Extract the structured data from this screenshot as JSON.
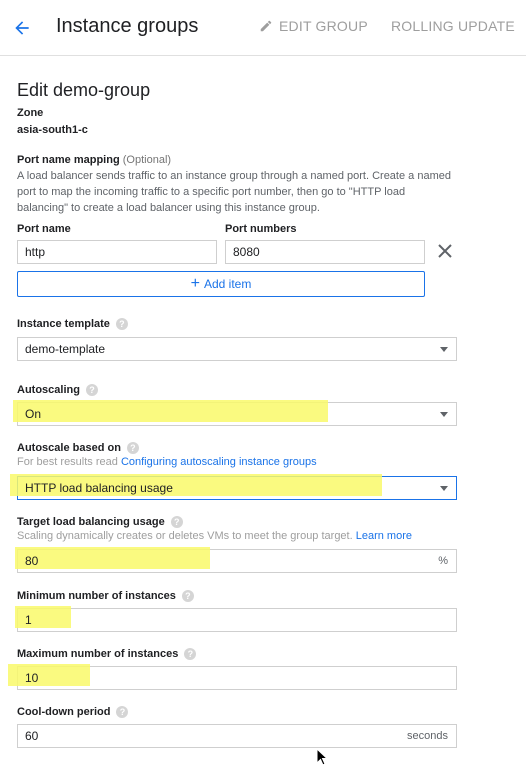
{
  "header": {
    "title": "Instance groups",
    "edit_group": "EDIT GROUP",
    "rolling_update": "ROLLING UPDATE"
  },
  "form": {
    "title": "Edit demo-group",
    "zone": {
      "label": "Zone",
      "value": "asia-south1-c"
    },
    "port_mapping": {
      "label": "Port name mapping",
      "optional": "(Optional)",
      "description": "A load balancer sends traffic to an instance group through a named port. Create a named port to map the incoming traffic to a specific port number, then go to \"HTTP load balancing\" to create a load balancer using this instance group.",
      "port_name_label": "Port name",
      "port_numbers_label": "Port numbers",
      "port_name_value": "http",
      "port_numbers_value": "8080",
      "add_item": "Add item"
    },
    "instance_template": {
      "label": "Instance template",
      "value": "demo-template"
    },
    "autoscaling": {
      "label": "Autoscaling",
      "value": "On"
    },
    "autoscale_based_on": {
      "label": "Autoscale based on",
      "hint_prefix": "For best results read ",
      "hint_link": "Configuring autoscaling instance groups",
      "value": "HTTP load balancing usage"
    },
    "target_lb_usage": {
      "label": "Target load balancing usage",
      "hint": "Scaling dynamically creates or deletes VMs to meet the group target.",
      "hint_link": "Learn more",
      "value": "80",
      "suffix": "%"
    },
    "min_instances": {
      "label": "Minimum number of instances",
      "value": "1"
    },
    "max_instances": {
      "label": "Maximum number of instances",
      "value": "10"
    },
    "cooldown": {
      "label": "Cool-down period",
      "value": "60",
      "suffix": "seconds"
    }
  },
  "colors": {
    "accent": "#1a73e8",
    "highlight": "#f9f96a",
    "muted": "#9e9e9e"
  },
  "icons": [
    "arrow-back-icon",
    "pencil-icon",
    "help-icon",
    "close-icon",
    "plus-icon",
    "dropdown-caret-icon",
    "mouse-cursor-icon"
  ]
}
